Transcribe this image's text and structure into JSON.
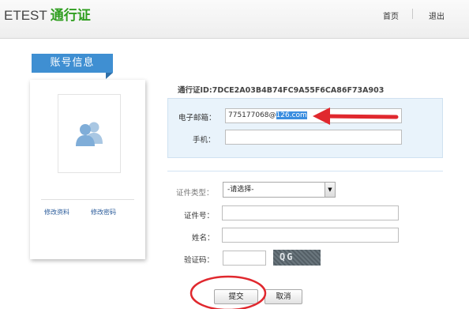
{
  "header": {
    "brand_en": "ETEST",
    "brand_cn": "通行证",
    "nav_home": "首页",
    "nav_logout": "退出"
  },
  "sidebar": {
    "tab_label": "账号信息",
    "avatar_icon": "users-icon",
    "edit_profile": "修改资料",
    "edit_password": "修改密码"
  },
  "account": {
    "pass_id": "通行证ID:7DCE2A03B4B74FC9A55F6CA86F73A903"
  },
  "contact": {
    "email_label": "电子邮箱：",
    "email_value_prefix": "775177068@",
    "email_value_selected": "126.com",
    "phone_label": "手机：",
    "phone_value": ""
  },
  "identity": {
    "id_type_label": "证件类型：",
    "id_type_selected": "-请选择-",
    "id_number_label": "证件号：",
    "name_label": "姓名：",
    "captcha_label": "验证码："
  },
  "captcha_image_text": "QG",
  "actions": {
    "submit": "提交",
    "cancel": "取消"
  },
  "colors": {
    "brand_green": "#2f9e1f",
    "tab_blue": "#3f8fd2",
    "contact_bg": "#e9f3fb",
    "annotation_red": "#e0282e"
  }
}
